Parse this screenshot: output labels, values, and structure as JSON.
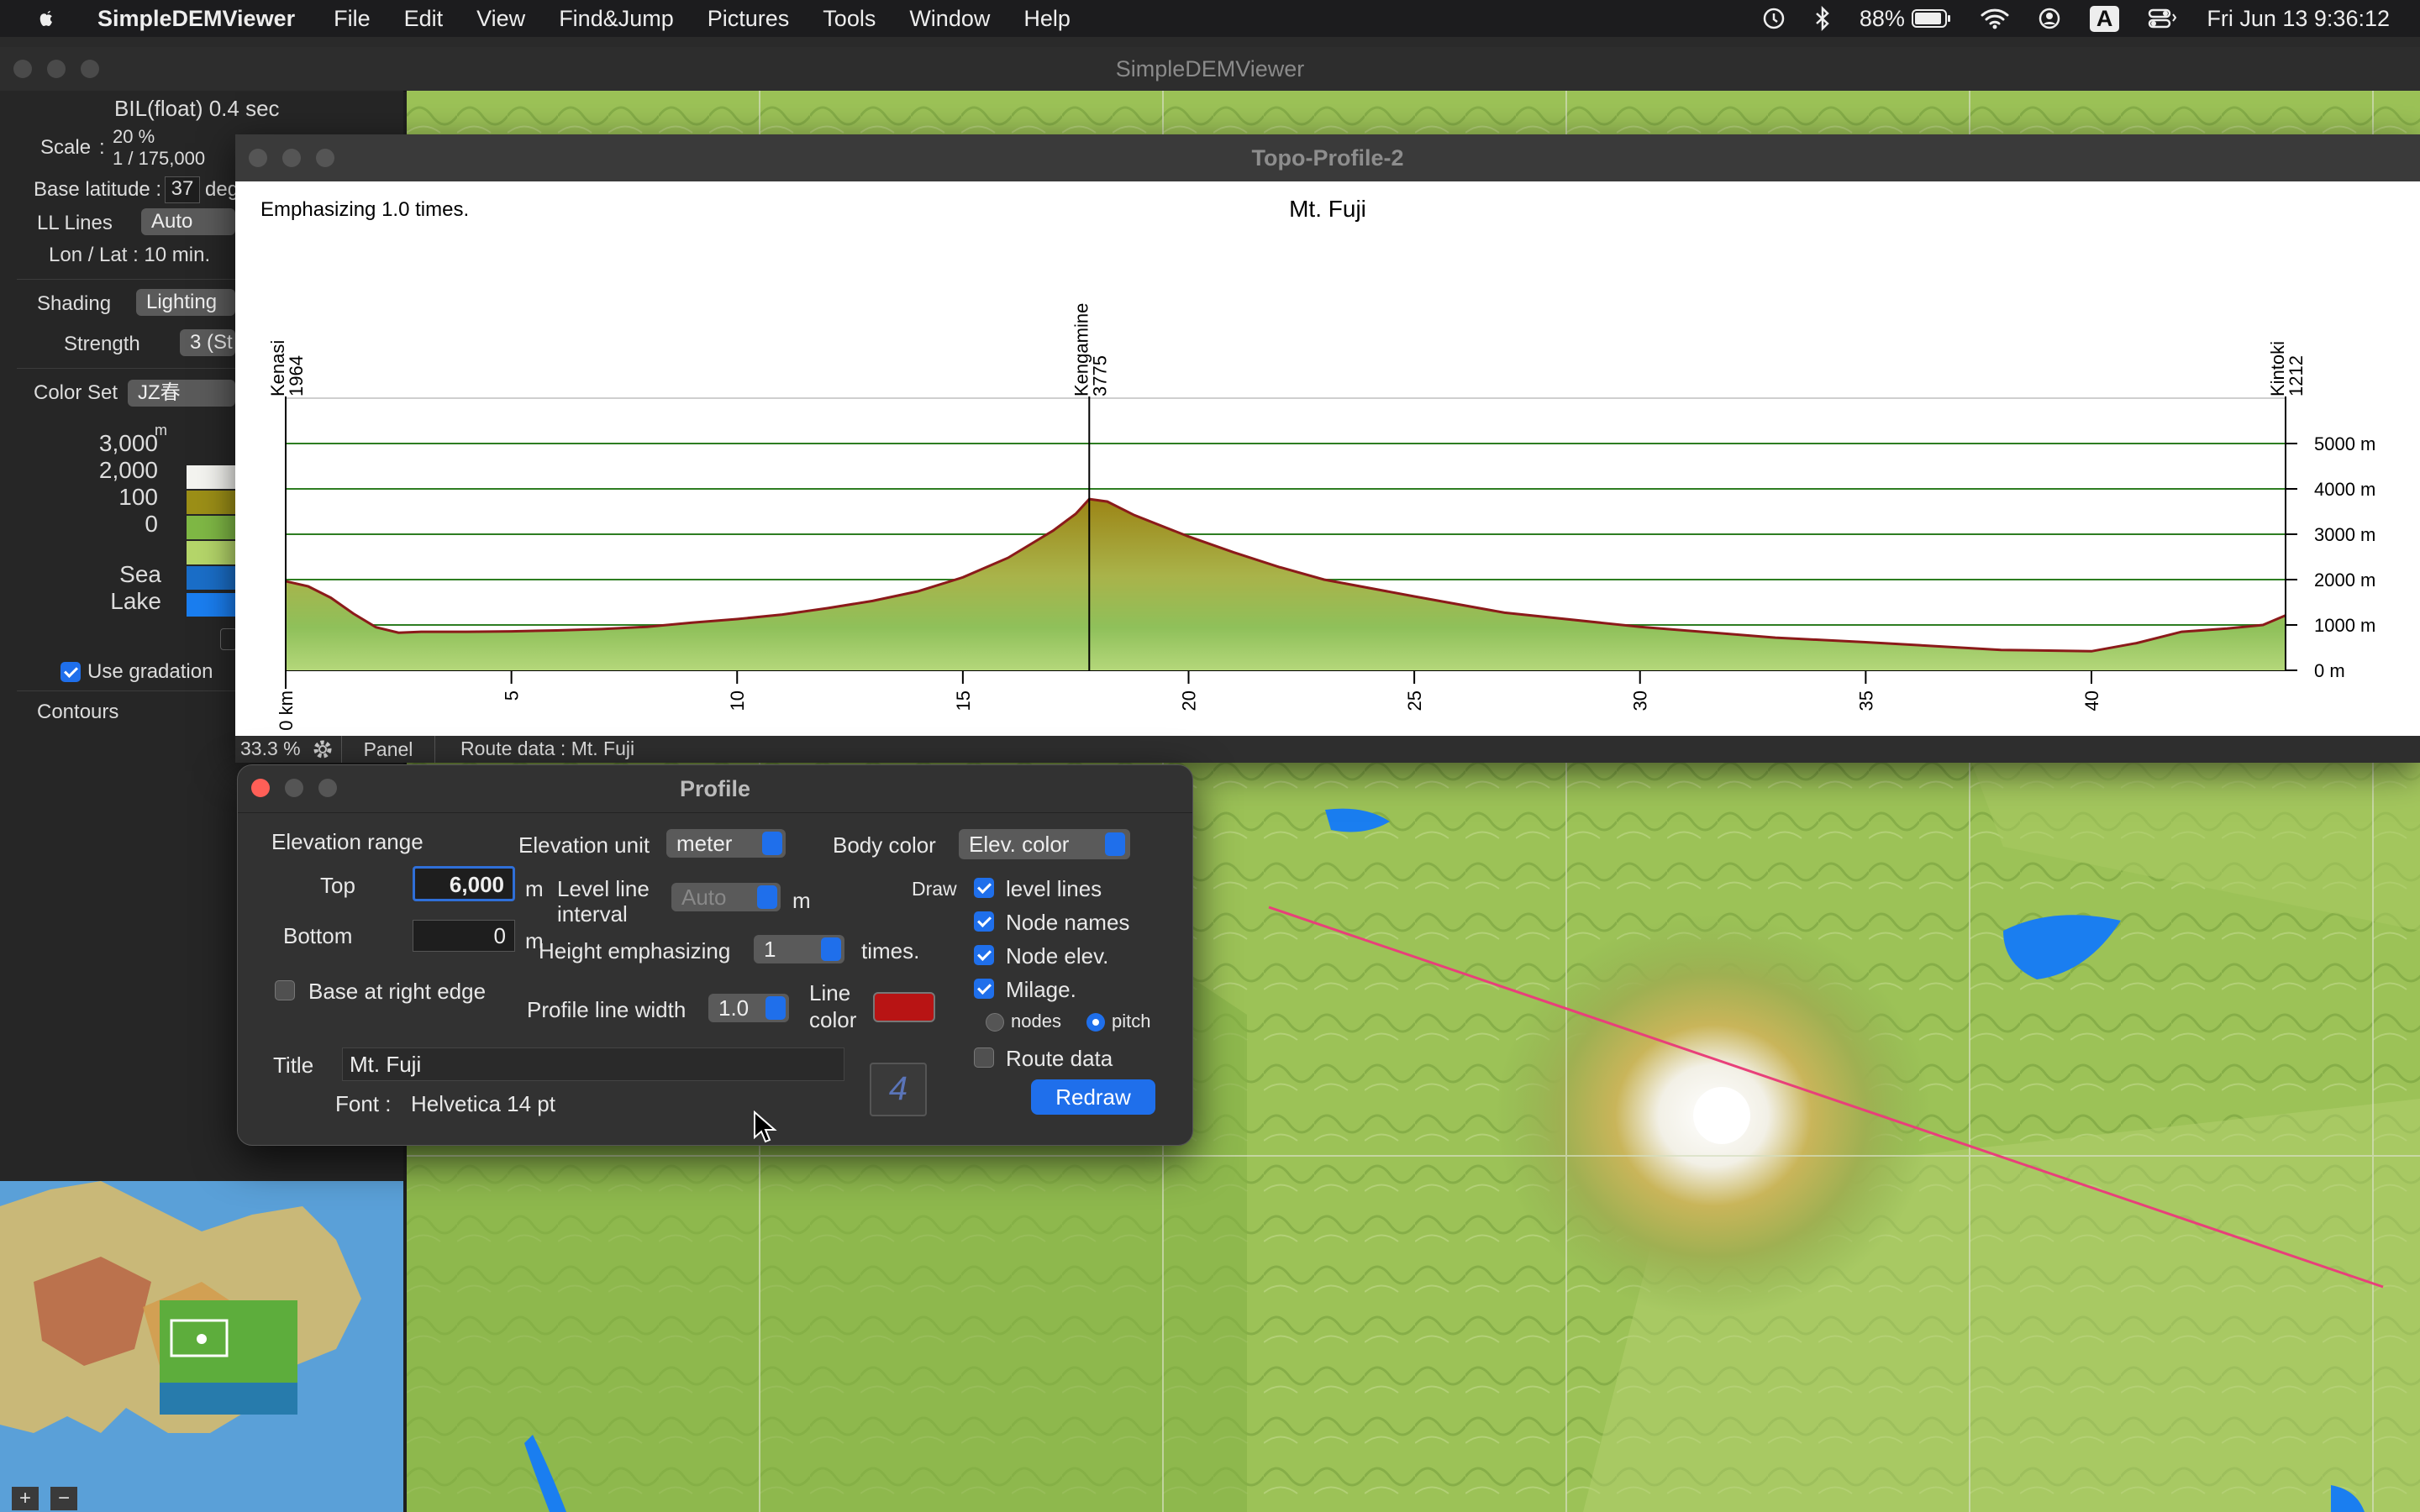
{
  "menubar": {
    "app_name": "SimpleDEMViewer",
    "items": [
      "File",
      "Edit",
      "View",
      "Find&Jump",
      "Pictures",
      "Tools",
      "Window",
      "Help"
    ],
    "battery": "88%",
    "input_source": "A",
    "clock": "Fri Jun 13  9:36:12"
  },
  "main_window": {
    "title": "SimpleDEMViewer"
  },
  "sidebar": {
    "file_info": "BIL(float) 0.4 sec",
    "scale_label": "Scale",
    "scale_percent": "20 %",
    "scale_ratio": "1 / 175,000",
    "base_latitude_label": "Base latitude :",
    "base_latitude_value": "37",
    "base_latitude_unit": "deg",
    "ll_lines_label": "LL Lines",
    "ll_lines_value": "Auto",
    "lon_lat": "Lon / Lat : 10 min.",
    "shading_label": "Shading",
    "shading_value": "Lighting",
    "strength_label": "Strength",
    "strength_value": "3 (St",
    "color_set_label": "Color Set",
    "color_set_value": "JZ春",
    "unit_m": "m",
    "legend": [
      {
        "label": "3,000",
        "color": "#f4f4f0"
      },
      {
        "label": "2,000",
        "color": "#9c8f17"
      },
      {
        "label": "100",
        "color": "#7fb845"
      },
      {
        "label": "0",
        "color": "#b5d66a"
      }
    ],
    "sea_label": "Sea",
    "sea_color": "#1a6ec8",
    "lake_label": "Lake",
    "lake_color": "#1a7ef0",
    "use_gradation_label": "Use gradation",
    "contours_label": "Contours",
    "zoom_in": "+",
    "zoom_out": "−"
  },
  "topo_window": {
    "title": "Topo-Profile-2",
    "emphasis_note": "Emphasizing 1.0 times.",
    "zoom": "33.3 %",
    "panel_button": "Panel",
    "route_data": "Route data :  Mt. Fuji"
  },
  "chart_data": {
    "type": "area",
    "title": "Mt. Fuji",
    "xlabel": "",
    "ylabel": "",
    "x_unit": "km",
    "y_unit": "m",
    "xlim": [
      0,
      44.3
    ],
    "ylim": [
      0,
      6000
    ],
    "x_ticks": [
      0,
      5,
      10,
      15,
      20,
      25,
      30,
      35,
      40
    ],
    "x_tick_labels": [
      "0 km",
      "5",
      "10",
      "15",
      "20",
      "25",
      "30",
      "35",
      "40"
    ],
    "y_ticks": [
      0,
      1000,
      2000,
      3000,
      4000,
      5000
    ],
    "y_tick_labels": [
      "0 m",
      "1000 m",
      "2000 m",
      "3000 m",
      "4000 m",
      "5000 m"
    ],
    "nodes": [
      {
        "name": "Kenasi",
        "elev": "1964",
        "x": 0
      },
      {
        "name": "Kengamine",
        "elev": "3775",
        "x": 17.8
      },
      {
        "name": "Kintoki",
        "elev": "1212",
        "x": 44.3
      }
    ],
    "x": [
      0,
      0.5,
      1,
      1.5,
      2,
      2.5,
      3,
      4,
      5,
      6,
      7,
      8,
      9,
      10,
      11,
      12,
      13,
      14,
      15,
      16,
      17,
      17.5,
      17.8,
      18.2,
      18.8,
      20,
      21,
      22,
      23,
      25,
      27,
      30,
      33,
      35,
      38,
      40,
      41,
      42,
      43,
      43.8,
      44.3
    ],
    "y": [
      1964,
      1850,
      1600,
      1250,
      950,
      830,
      850,
      850,
      860,
      880,
      910,
      960,
      1050,
      1130,
      1230,
      1370,
      1530,
      1740,
      2050,
      2480,
      3080,
      3450,
      3775,
      3720,
      3420,
      2950,
      2600,
      2280,
      2000,
      1630,
      1270,
      960,
      720,
      620,
      450,
      420,
      600,
      850,
      920,
      1000,
      1212
    ],
    "line_color": "#8b1a1a",
    "grid": true
  },
  "profile_dialog": {
    "title": "Profile",
    "elevation_range_label": "Elevation range",
    "top_label": "Top",
    "top_value": "6,000",
    "bottom_label": "Bottom",
    "bottom_value": "0",
    "unit_m": "m",
    "base_right_label": "Base at right edge",
    "elevation_unit_label": "Elevation unit",
    "elevation_unit_value": "meter",
    "level_interval_label1": "Level line",
    "level_interval_label2": "interval",
    "level_interval_value": "Auto",
    "height_emph_label": "Height emphasizing",
    "height_emph_value": "1",
    "times_label": "times.",
    "line_width_label": "Profile line width",
    "line_width_value": "1.0",
    "line_color_label1": "Line",
    "line_color_label2": "color",
    "line_color": "#b81414",
    "body_color_label": "Body color",
    "body_color_value": "Elev. color",
    "draw_label": "Draw",
    "level_lines_label": "level lines",
    "node_names_label": "Node names",
    "node_elev_label": "Node elev.",
    "milage_label": "Milage.",
    "nodes_radio_label": "nodes",
    "pitch_radio_label": "pitch",
    "route_data_label": "Route data",
    "title_label": "Title",
    "title_value": "Mt. Fuji",
    "font_label": "Font :",
    "font_value": "Helvetica 14 pt",
    "redraw_button": "Redraw"
  }
}
